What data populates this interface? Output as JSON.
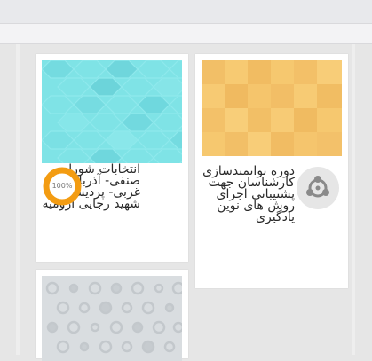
{
  "cards": [
    {
      "title": "انتخابات شورای صنفی- آذربایجان غربی- پردیس شهید رجایی ارومیه",
      "progress_label": "100%",
      "progress_value": 100,
      "image_color": "#7fe3e6"
    },
    {
      "title": "دوره توانمندسازی کارشناسان جهت پشتیبانی اجرای روش های نوین یادگیری",
      "icon": "course-share-icon",
      "image_color": "#f5c46b"
    },
    {
      "image_color": "#d9dde0"
    }
  ],
  "colors": {
    "progress_ring": "#f39c12",
    "page_background": "#e6e6e6"
  }
}
